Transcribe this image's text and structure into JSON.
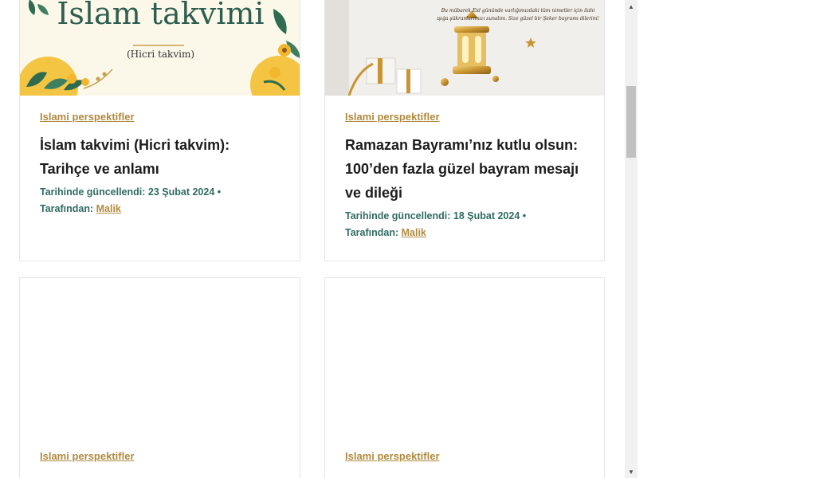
{
  "cards": [
    {
      "image": {
        "title": "İslam takvimi",
        "subtitle": "(Hicri takvim)"
      },
      "category": "Islami perspektifler",
      "title": "İslam takvimi (Hicri takvim): Tarihçe ve anlamı",
      "updated": "Tarihinde güncellendi: 23 Şubat 2024 •",
      "by_label": "Tarafından:",
      "author": "Malik"
    },
    {
      "image": {
        "caption": "Bu mübarek Eid gününde varlığımızdaki tüm nimetler için ilahi ışığa şükranlarımızı sunalım. Size güzel bir Şeker bayramı dilerim!"
      },
      "category": "Islami perspektifler",
      "title": "Ramazan Bayramı’nız kutlu olsun: 100’den fazla güzel bayram mesajı ve dileği",
      "updated": "Tarihinde güncellendi: 18 Şubat 2024 •",
      "by_label": "Tarafından:",
      "author": "Malik"
    },
    {
      "category": "Islami perspektifler"
    },
    {
      "category": "Islami perspektifler"
    }
  ],
  "scrollbar": {
    "up_icon": "triangle-up-icon",
    "down_icon": "triangle-down-icon"
  },
  "colors": {
    "accent_gold": "#b08a3e",
    "meta_teal": "#2f6b62",
    "heading_green": "#2e5e4f",
    "card_border": "#e6e6e6"
  }
}
